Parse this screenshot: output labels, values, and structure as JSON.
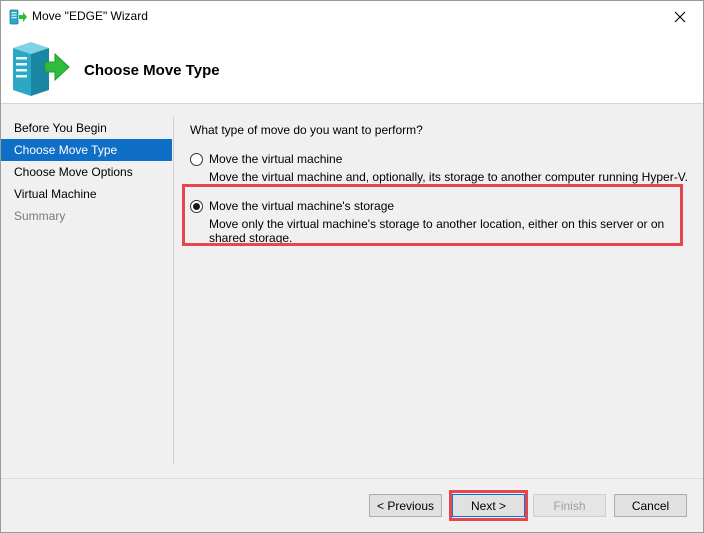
{
  "window": {
    "title": "Move \"EDGE\" Wizard",
    "close_glyph": "✕"
  },
  "header": {
    "title": "Choose Move Type"
  },
  "nav": {
    "items": [
      {
        "label": "Before You Begin",
        "state": "normal"
      },
      {
        "label": "Choose Move Type",
        "state": "active"
      },
      {
        "label": "Choose Move Options",
        "state": "normal"
      },
      {
        "label": "Virtual Machine",
        "state": "normal"
      },
      {
        "label": "Summary",
        "state": "disabled"
      }
    ]
  },
  "content": {
    "question": "What type of move do you want to perform?",
    "options": [
      {
        "label": "Move the virtual machine",
        "description": "Move the virtual machine and, optionally, its storage to another computer running Hyper-V.",
        "selected": false
      },
      {
        "label": "Move the virtual machine's storage",
        "description": "Move only the virtual machine's storage to another location, either on this server or on shared storage.",
        "selected": true
      }
    ]
  },
  "buttons": {
    "previous": "< Previous",
    "next": "Next >",
    "finish": "Finish",
    "cancel": "Cancel"
  },
  "colors": {
    "accent": "#0f6fc6",
    "highlight": "#e8464f",
    "arrow_green": "#2dbd3a",
    "server_teal": "#2aa8c6"
  }
}
